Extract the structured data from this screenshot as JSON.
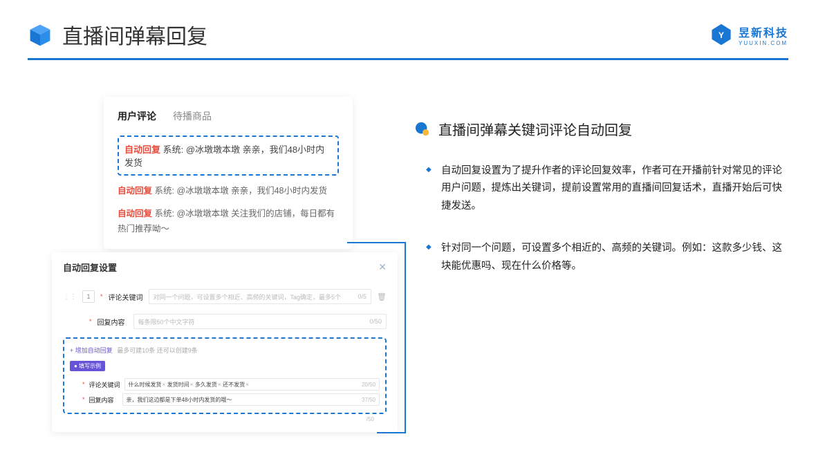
{
  "header": {
    "title": "直播间弹幕回复",
    "brand_cn": "昱新科技",
    "brand_en": "YUUXIN.COM"
  },
  "comments_card": {
    "tab_active": "用户评论",
    "tab_inactive": "待播商品",
    "highlight_badge": "自动回复",
    "highlight_text": "系统: @冰墩墩本墩 亲亲，我们48小时内发货",
    "row2_badge": "自动回复",
    "row2_text": "系统: @冰墩墩本墩 亲亲，我们48小时内发货",
    "row3_badge": "自动回复",
    "row3_text": "系统: @冰墩墩本墩 关注我们的店铺，每日都有热门推荐呦～"
  },
  "settings_card": {
    "title": "自动回复设置",
    "idx": "1",
    "field1_label": "评论关键词",
    "field1_placeholder": "对同一个问题，可设置多个相近、高频的关键词，Tag确定，最多5个",
    "field1_count": "0/5",
    "field2_label": "回复内容",
    "field2_placeholder": "每条限50个中文字符",
    "field2_count": "0/50",
    "add_link": "+ 增加自动回复",
    "add_link_note": "最多可建10条 还可以创建9条",
    "template_badge": "● 填写示例",
    "ex1_label": "评论关键词",
    "ex1_tag1": "什么时候发货",
    "ex1_tag2": "发货时间",
    "ex1_tag3": "多久发货",
    "ex1_tag4": "还不发货",
    "ex1_count": "20/50",
    "ex2_label": "回复内容",
    "ex2_text": "亲，我们这边都是下单48小时内发货的哦～",
    "ex2_count": "37/50",
    "under_count": "/50"
  },
  "right": {
    "section_title": "直播间弹幕关键词评论自动回复",
    "bullet1": "自动回复设置为了提升作者的评论回复效率，作者可在开播前针对常见的评论用户问题，提炼出关键词，提前设置常用的直播间回复话术，直播开始后可快捷发送。",
    "bullet2": "针对同一个问题，可设置多个相近的、高频的关键词。例如：这款多少钱、这块能优惠吗、现在什么价格等。"
  }
}
